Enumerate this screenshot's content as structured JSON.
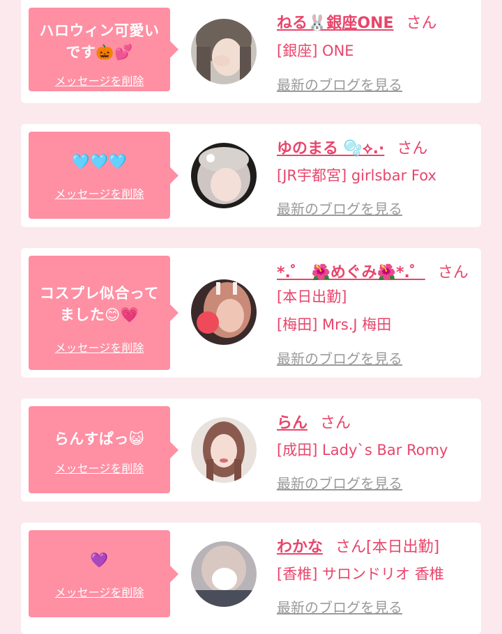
{
  "cards": [
    {
      "message_lines": [
        "ハロウィン可愛い",
        "です🎃💕"
      ],
      "delete_label": "メッセージを削除",
      "name": "ねる🐰銀座ONE",
      "honorific": "さん",
      "tag": "",
      "location": "[銀座] ONE",
      "blog_link": "最新のブログを見る"
    },
    {
      "message_lines": [
        "🩵🩵🩵"
      ],
      "delete_label": "メッセージを削除",
      "name": "ゆのまる 🫧⟡.·",
      "honorific": "さん",
      "tag": "",
      "location": "[JR宇都宮] girlsbar Fox",
      "blog_link": "最新のブログを見る"
    },
    {
      "message_lines": [
        "コスプレ似合って",
        "ました😊💗"
      ],
      "delete_label": "メッセージを削除",
      "name": "*.゜ 🌺めぐみ🌺*.゜",
      "honorific": "さん",
      "tag": "[本日出勤]",
      "location": "[梅田] Mrs.J 梅田",
      "blog_link": "最新のブログを見る"
    },
    {
      "message_lines": [
        "らんすぱっ😺"
      ],
      "delete_label": "メッセージを削除",
      "name": "らん",
      "honorific": "さん",
      "tag": "",
      "location": "[成田] Lady`s Bar Romy",
      "blog_link": "最新のブログを見る"
    },
    {
      "message_lines": [
        "💜"
      ],
      "delete_label": "メッセージを削除",
      "name": "わかな",
      "honorific": "さん[本日出勤]",
      "tag": "",
      "location": "[香椎] サロンドリオ 香椎",
      "blog_link": "最新のブログを見る"
    }
  ],
  "colors": {
    "page_background": "#fbe9ee",
    "card_background": "#ffffff",
    "bubble": "#ff8fa3",
    "accent_text": "#e8456b",
    "link_gray": "#9a9a9a"
  }
}
